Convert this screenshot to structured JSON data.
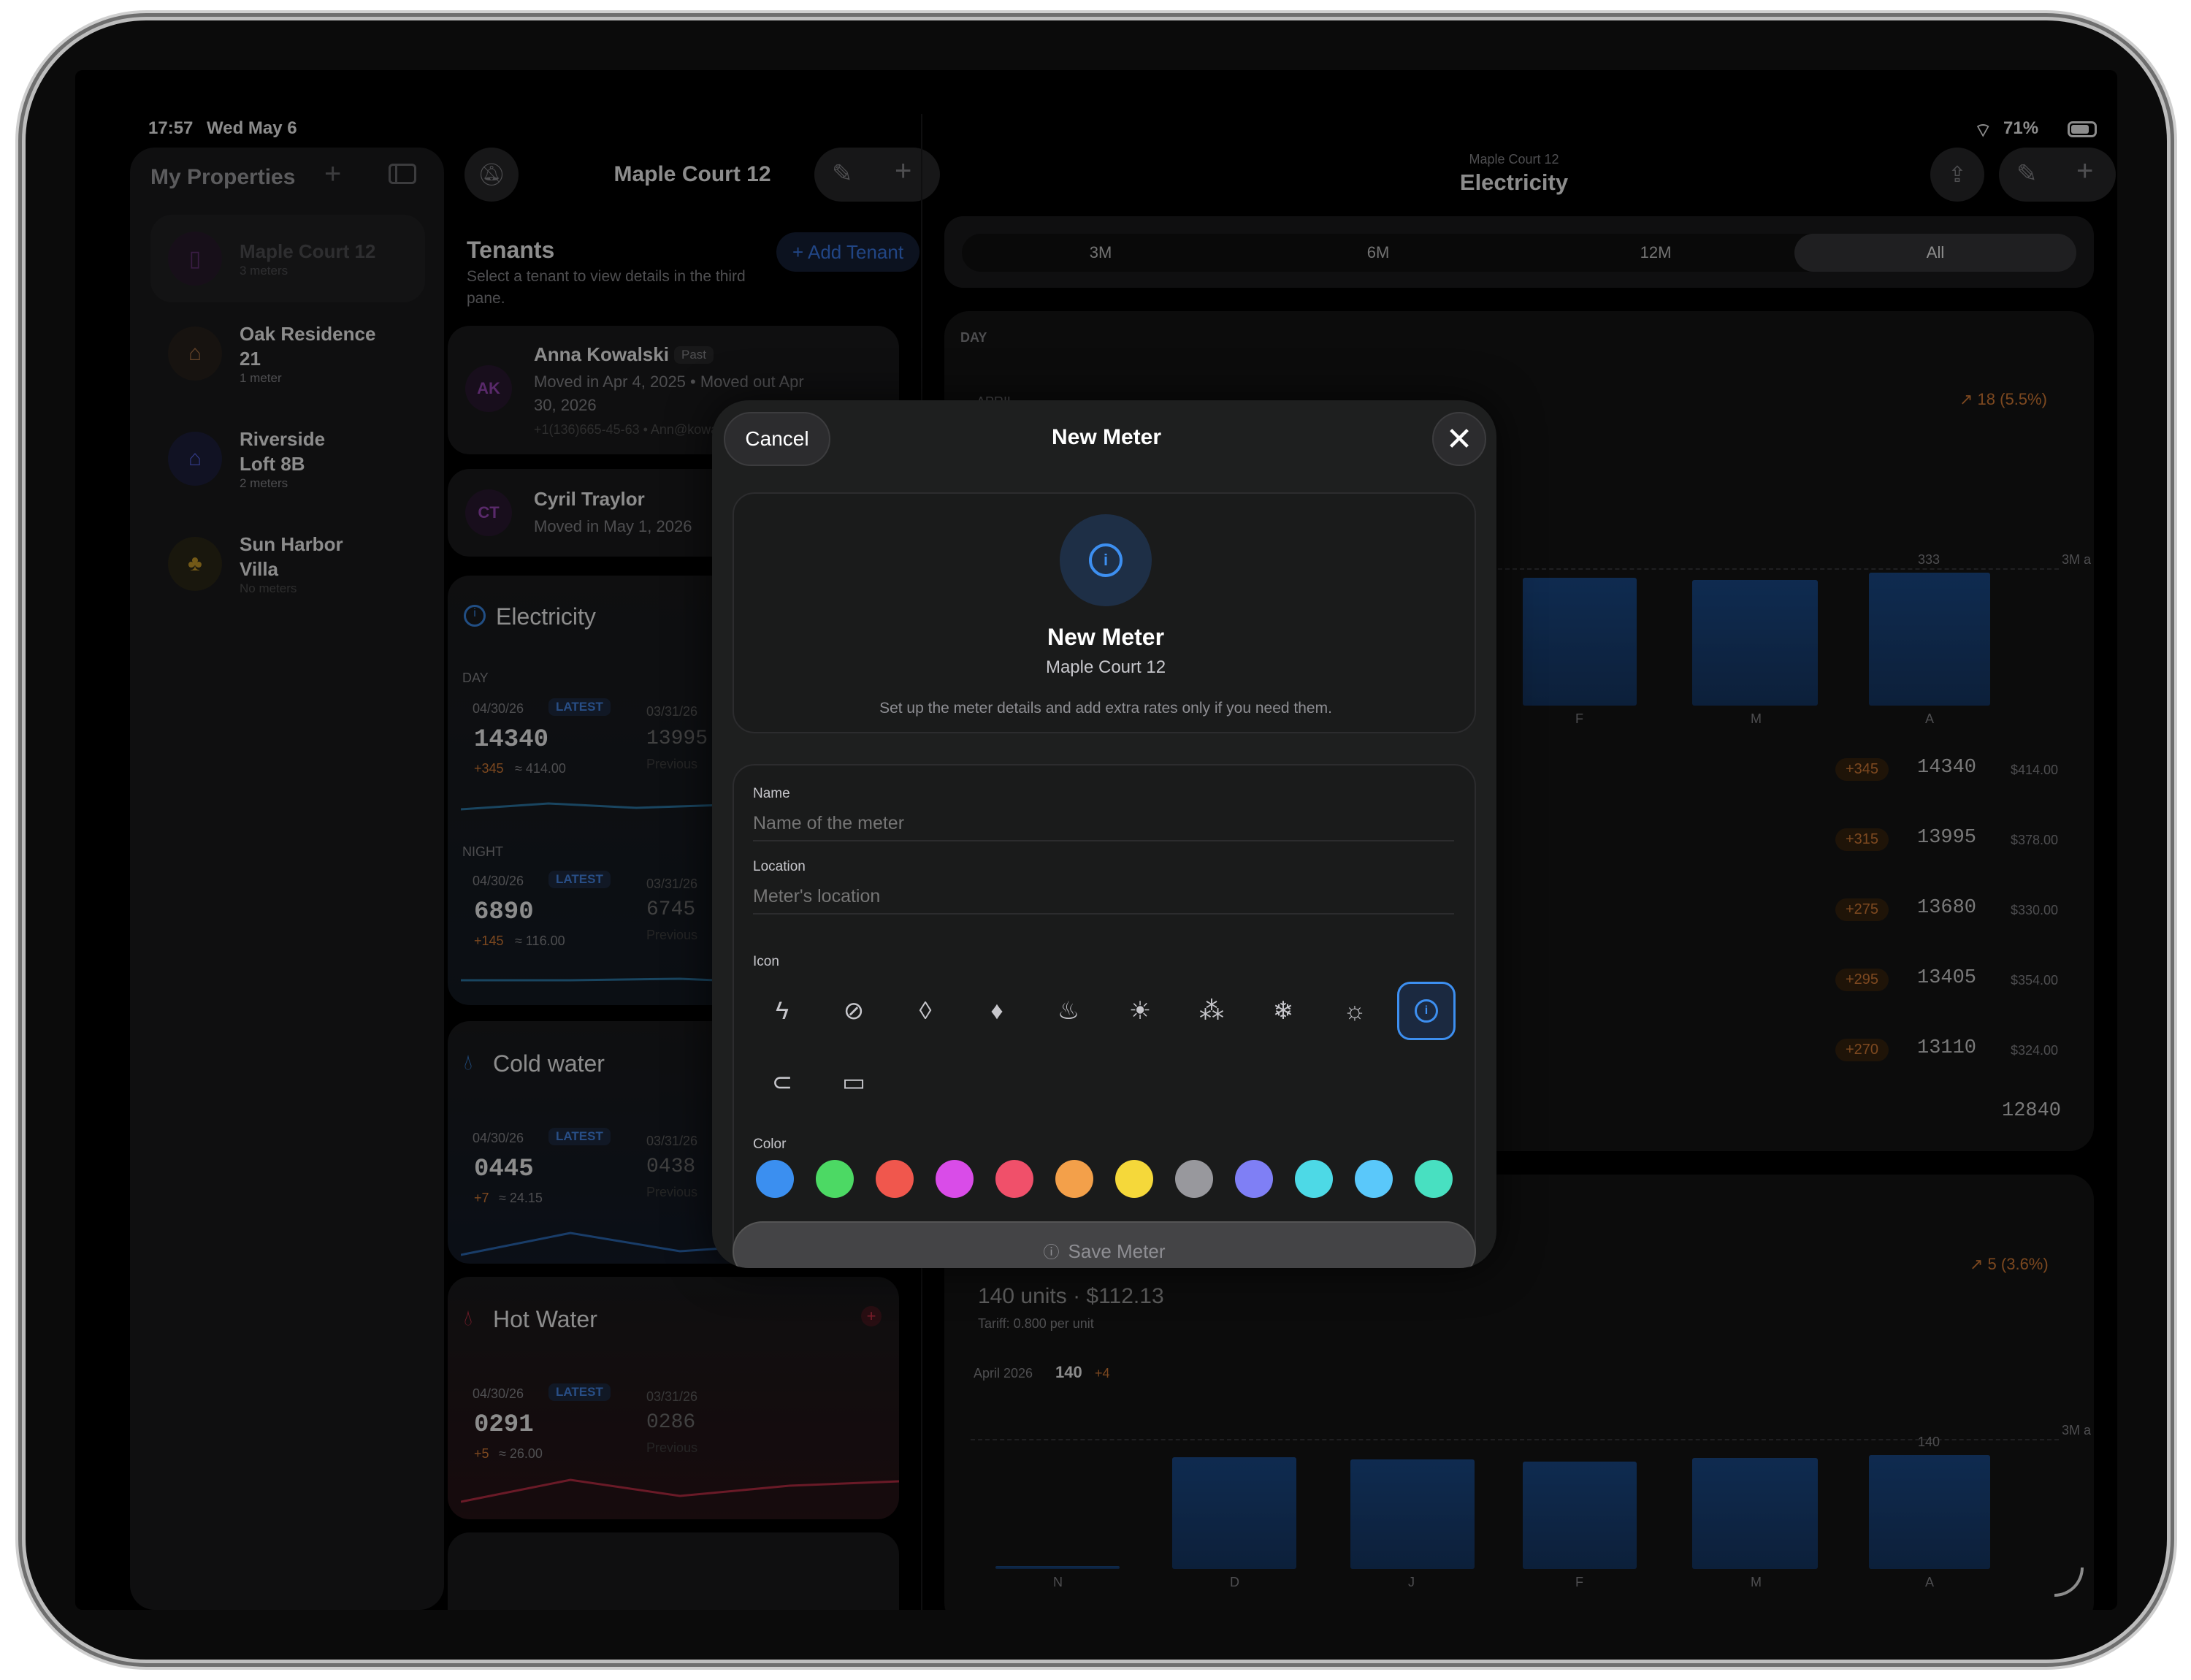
{
  "status": {
    "time": "17:57",
    "date": "Wed May 6",
    "battery": "71%"
  },
  "sidebar": {
    "title": "My Properties",
    "properties": [
      {
        "name": "Maple Court 12",
        "sub": "3 meters",
        "color": "#8a2fa8",
        "icon": "building-icon"
      },
      {
        "name": "Oak Residence 21",
        "sub": "1 meter",
        "color": "#b77a4a",
        "icon": "house-icon"
      },
      {
        "name": "Riverside Loft 8B",
        "sub": "2 meters",
        "color": "#3f4ec4",
        "icon": "home-icon"
      },
      {
        "name": "Sun Harbor Villa",
        "sub": "No meters",
        "color": "#d1a32a",
        "icon": "tree-icon"
      }
    ]
  },
  "middle": {
    "title": "Maple Court 12",
    "tenants_title": "Tenants",
    "tenants_hint": "Select a tenant to view details in the third pane.",
    "add_tenant": "+ Add Tenant",
    "tenants": [
      {
        "initials": "AK",
        "name": "Anna Kowalski",
        "badge": "Past",
        "line1": "Moved in Apr 4, 2025 • Moved out Apr",
        "line2": "30, 2026",
        "contact": "+1(136)665-45-63 • Ann@kowa..."
      },
      {
        "initials": "CT",
        "name": "Cyril Traylor",
        "line1": "Moved in May 1, 2026"
      }
    ],
    "meters": [
      {
        "name": "Electricity",
        "sections": [
          {
            "label": "DAY",
            "date": "04/30/26",
            "latest": "LATEST",
            "value": "14340",
            "delta": "+345",
            "cost": "≈ 414.00",
            "prev_date": "03/31/26",
            "prev_value": "13995",
            "prev_label": "Previous"
          },
          {
            "label": "NIGHT",
            "date": "04/30/26",
            "latest": "LATEST",
            "value": "6890",
            "delta": "+145",
            "cost": "≈ 116.00",
            "prev_date": "03/31/26",
            "prev_value": "6745",
            "prev_label": "Previous"
          }
        ]
      },
      {
        "name": "Cold water",
        "date": "04/30/26",
        "latest": "LATEST",
        "value": "0445",
        "delta": "+7",
        "cost": "≈ 24.15",
        "prev_date": "03/31/26",
        "prev_value": "0438",
        "prev_label": "Previous"
      },
      {
        "name": "Hot Water",
        "date": "04/30/26",
        "latest": "LATEST",
        "value": "0291",
        "delta": "+5",
        "cost": "≈ 26.00",
        "prev_date": "03/31/26",
        "prev_value": "0286",
        "prev_label": "Previous"
      }
    ]
  },
  "detail": {
    "subtitle": "Maple Court 12",
    "title": "Electricity",
    "ranges": [
      "3M",
      "6M",
      "12M",
      "All"
    ],
    "selected_range": "All",
    "day_label": "DAY",
    "month_label": "APRIL",
    "trend1": "↗ 18 (5.5%)",
    "avg_label": "3M a",
    "chart1": {
      "type": "bar",
      "categories": [
        "F",
        "M",
        "A"
      ],
      "values": [
        320,
        315,
        333
      ],
      "top_label": "333"
    },
    "rows": [
      {
        "delta": "+345",
        "value": "14340",
        "usd": "$414.00"
      },
      {
        "delta": "+315",
        "value": "13995",
        "usd": "$378.00"
      },
      {
        "delta": "+275",
        "value": "13680",
        "usd": "$330.00"
      },
      {
        "delta": "+295",
        "value": "13405",
        "usd": "$354.00"
      },
      {
        "delta": "+270",
        "value": "13110",
        "usd": "$324.00"
      }
    ],
    "last_value": "12840",
    "units_line": "140 units · $112.13",
    "tariff": "Tariff: 0.800 per unit",
    "trend2": "↗ 5 (3.6%)",
    "period": "April 2026",
    "period_value": "140",
    "period_delta": "+4",
    "chart2": {
      "type": "bar",
      "categories": [
        "N",
        "D",
        "J",
        "F",
        "M",
        "A"
      ],
      "values": [
        3,
        137,
        135,
        132,
        136,
        140
      ],
      "top_label": "140"
    }
  },
  "chart_data": [
    {
      "type": "bar",
      "categories": [
        "F",
        "M",
        "A"
      ],
      "values": [
        320,
        315,
        333
      ],
      "title": "",
      "xlabel": "",
      "ylabel": ""
    },
    {
      "type": "bar",
      "categories": [
        "N",
        "D",
        "J",
        "F",
        "M",
        "A"
      ],
      "values": [
        3,
        137,
        135,
        132,
        136,
        140
      ],
      "title": "",
      "xlabel": "",
      "ylabel": ""
    }
  ],
  "modal": {
    "cancel": "Cancel",
    "title": "New Meter",
    "preview_title": "New Meter",
    "preview_sub": "Maple Court 12",
    "preview_hint": "Set up the meter details and add extra rates only if you need them.",
    "name_label": "Name",
    "name_placeholder": "Name of the meter",
    "location_label": "Location",
    "location_placeholder": "Meter's location",
    "icon_label": "Icon",
    "icons": [
      "bolt-icon",
      "bolt-circle-icon",
      "drop-outline-icon",
      "drop-icon",
      "flame-icon",
      "thermometer-sun-icon",
      "thermometer-snow-icon",
      "snowflake-icon",
      "sun-icon",
      "gauge-icon",
      "plug-icon",
      "router-icon"
    ],
    "selected_icon": "gauge-icon",
    "color_label": "Color",
    "colors": [
      "#3b8ff0",
      "#4cd964",
      "#f0574d",
      "#d94ce8",
      "#f0506a",
      "#f3a04a",
      "#f5d83a",
      "#98989d",
      "#7f7ff5",
      "#4dd9e6",
      "#5ac8fa",
      "#48e0c1"
    ],
    "save": "Save Meter"
  }
}
